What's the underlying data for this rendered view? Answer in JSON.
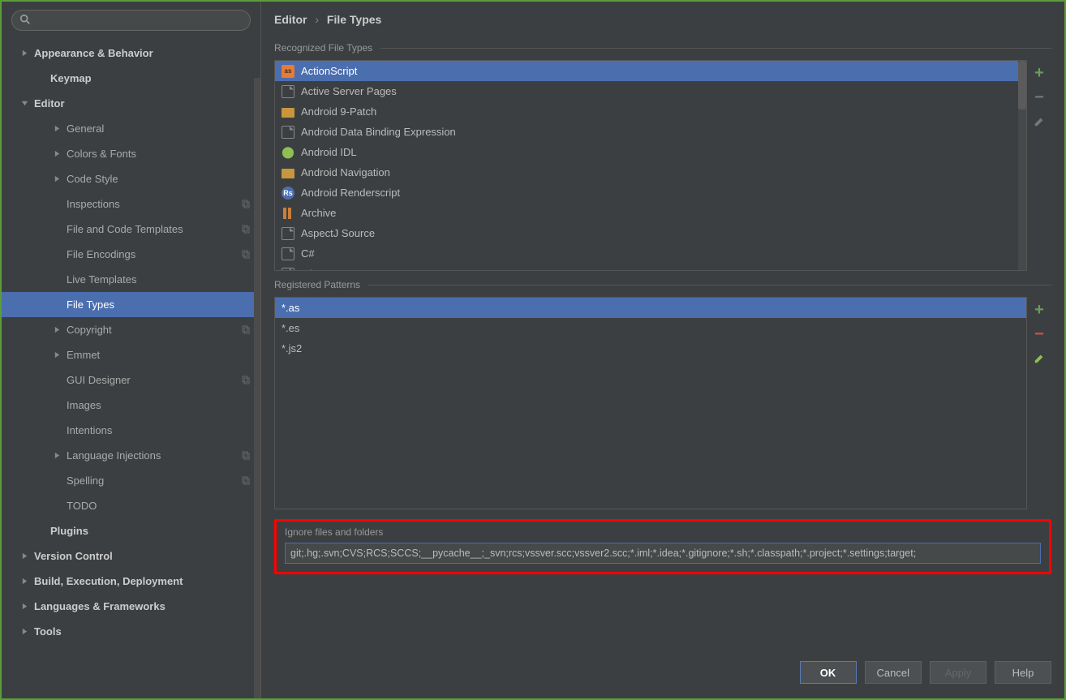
{
  "search": {
    "value": ""
  },
  "breadcrumb": {
    "parent": "Editor",
    "current": "File Types"
  },
  "sections": {
    "recognized": "Recognized File Types",
    "registered": "Registered Patterns",
    "ignore_label": "Ignore files and folders"
  },
  "ignore_value": "git;.hg;.svn;CVS;RCS;SCCS;__pycache__;_svn;rcs;vssver.scc;vssver2.scc;*.iml;*.idea;*.gitignore;*.sh;*.classpath;*.project;*.settings;target;",
  "tree": [
    {
      "label": "Appearance & Behavior",
      "level": 0,
      "caret": "right"
    },
    {
      "label": "Keymap",
      "level": 1,
      "caret": "none"
    },
    {
      "label": "Editor",
      "level": 0,
      "caret": "down"
    },
    {
      "label": "General",
      "level": 2,
      "caret": "right"
    },
    {
      "label": "Colors & Fonts",
      "level": 2,
      "caret": "right"
    },
    {
      "label": "Code Style",
      "level": 2,
      "caret": "right"
    },
    {
      "label": "Inspections",
      "level": 2,
      "caret": "none",
      "copy": true
    },
    {
      "label": "File and Code Templates",
      "level": 2,
      "caret": "none",
      "copy": true
    },
    {
      "label": "File Encodings",
      "level": 2,
      "caret": "none",
      "copy": true
    },
    {
      "label": "Live Templates",
      "level": 2,
      "caret": "none"
    },
    {
      "label": "File Types",
      "level": 2,
      "caret": "none",
      "selected": true
    },
    {
      "label": "Copyright",
      "level": 2,
      "caret": "right",
      "copy": true
    },
    {
      "label": "Emmet",
      "level": 2,
      "caret": "right"
    },
    {
      "label": "GUI Designer",
      "level": 2,
      "caret": "none",
      "copy": true
    },
    {
      "label": "Images",
      "level": 2,
      "caret": "none"
    },
    {
      "label": "Intentions",
      "level": 2,
      "caret": "none"
    },
    {
      "label": "Language Injections",
      "level": 2,
      "caret": "right",
      "copy": true
    },
    {
      "label": "Spelling",
      "level": 2,
      "caret": "none",
      "copy": true
    },
    {
      "label": "TODO",
      "level": 2,
      "caret": "none"
    },
    {
      "label": "Plugins",
      "level": 1,
      "caret": "none"
    },
    {
      "label": "Version Control",
      "level": 0,
      "caret": "right"
    },
    {
      "label": "Build, Execution, Deployment",
      "level": 0,
      "caret": "right"
    },
    {
      "label": "Languages & Frameworks",
      "level": 0,
      "caret": "right"
    },
    {
      "label": "Tools",
      "level": 0,
      "caret": "right"
    }
  ],
  "file_types": [
    {
      "label": "ActionScript",
      "icon": "as",
      "selected": true
    },
    {
      "label": "Active Server Pages",
      "icon": "file"
    },
    {
      "label": "Android 9-Patch",
      "icon": "folder"
    },
    {
      "label": "Android Data Binding Expression",
      "icon": "file"
    },
    {
      "label": "Android IDL",
      "icon": "android"
    },
    {
      "label": "Android Navigation",
      "icon": "folder"
    },
    {
      "label": "Android Renderscript",
      "icon": "rs"
    },
    {
      "label": "Archive",
      "icon": "archive"
    },
    {
      "label": "AspectJ Source",
      "icon": "file"
    },
    {
      "label": "C#",
      "icon": "file"
    },
    {
      "label": "C/C++",
      "icon": "file"
    }
  ],
  "patterns": [
    {
      "label": "*.as",
      "selected": true
    },
    {
      "label": "*.es"
    },
    {
      "label": "*.js2"
    }
  ],
  "buttons": {
    "ok": "OK",
    "cancel": "Cancel",
    "apply": "Apply",
    "help": "Help"
  }
}
